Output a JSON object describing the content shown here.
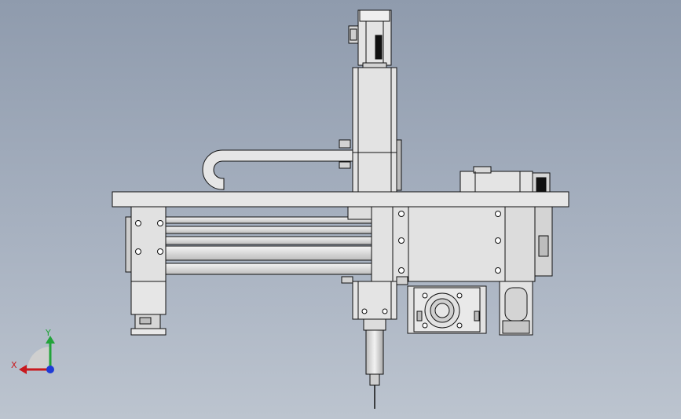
{
  "triad": {
    "y_label": "Y",
    "x_label": "X",
    "y_color": "#22a33a",
    "x_color": "#c8191e",
    "z_color": "#1f3bd6"
  },
  "colors": {
    "body": "#e1e1e1",
    "body_light": "#ececec",
    "body_dark": "#c9c9c9",
    "outline": "#111111",
    "background_top": "#8f9bad",
    "background_bottom": "#bcc4cf"
  }
}
